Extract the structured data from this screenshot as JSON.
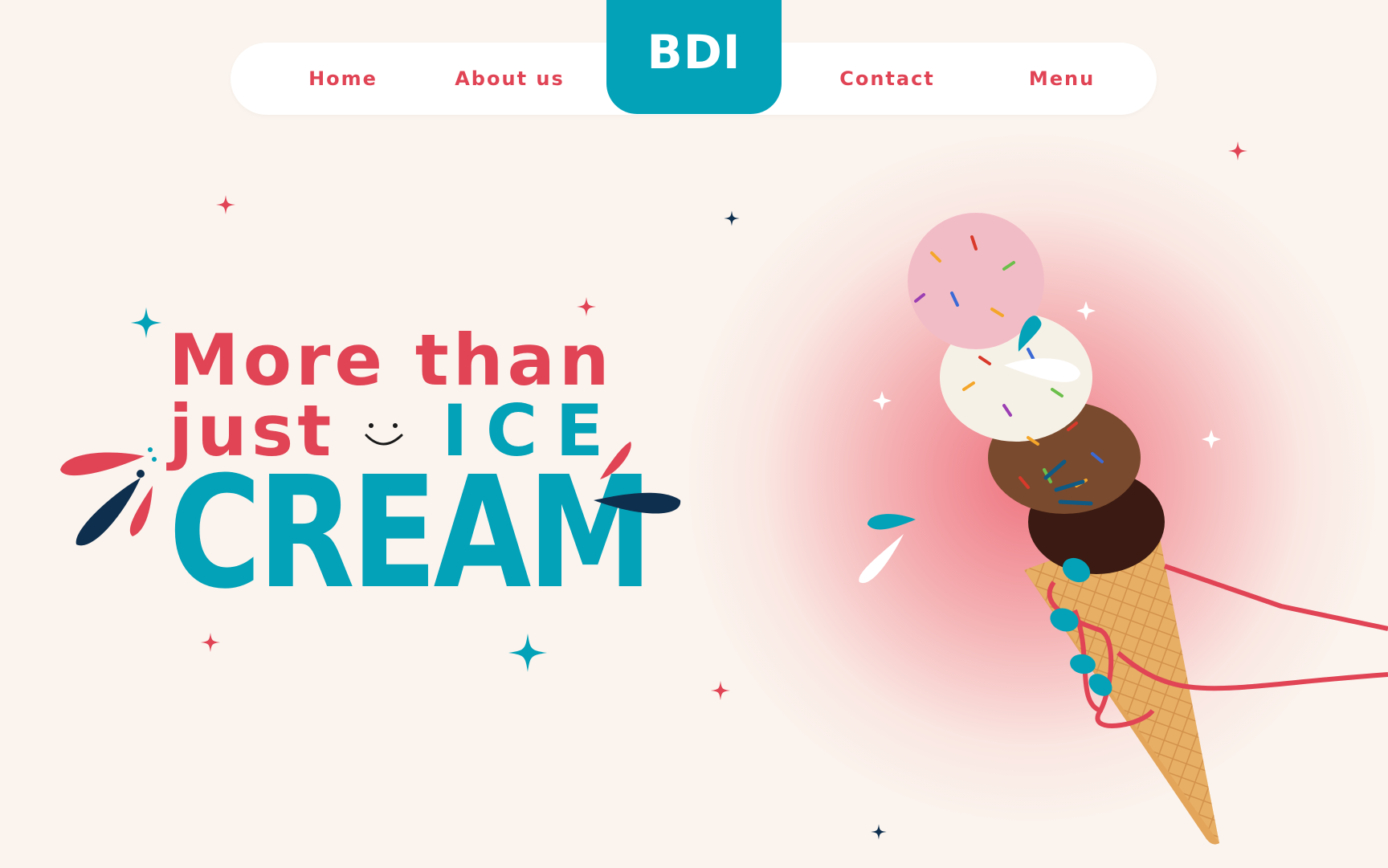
{
  "nav": {
    "links": [
      {
        "label": "Home"
      },
      {
        "label": "About us"
      },
      {
        "label": "Contact"
      },
      {
        "label": "Menu"
      }
    ],
    "logo": "BDI"
  },
  "hero": {
    "line1": "More than",
    "line2": "just",
    "ice": "ICE",
    "cream": "CREAM"
  },
  "colors": {
    "background": "#fbf4ee",
    "red": "#e04455",
    "teal": "#03a2b8",
    "navy": "#0e2f4e",
    "white": "#ffffff"
  },
  "icons": [
    "sparkle-icon",
    "smiley-icon",
    "splash-icon",
    "ice-cream-cone-image",
    "hand-outline-icon"
  ]
}
